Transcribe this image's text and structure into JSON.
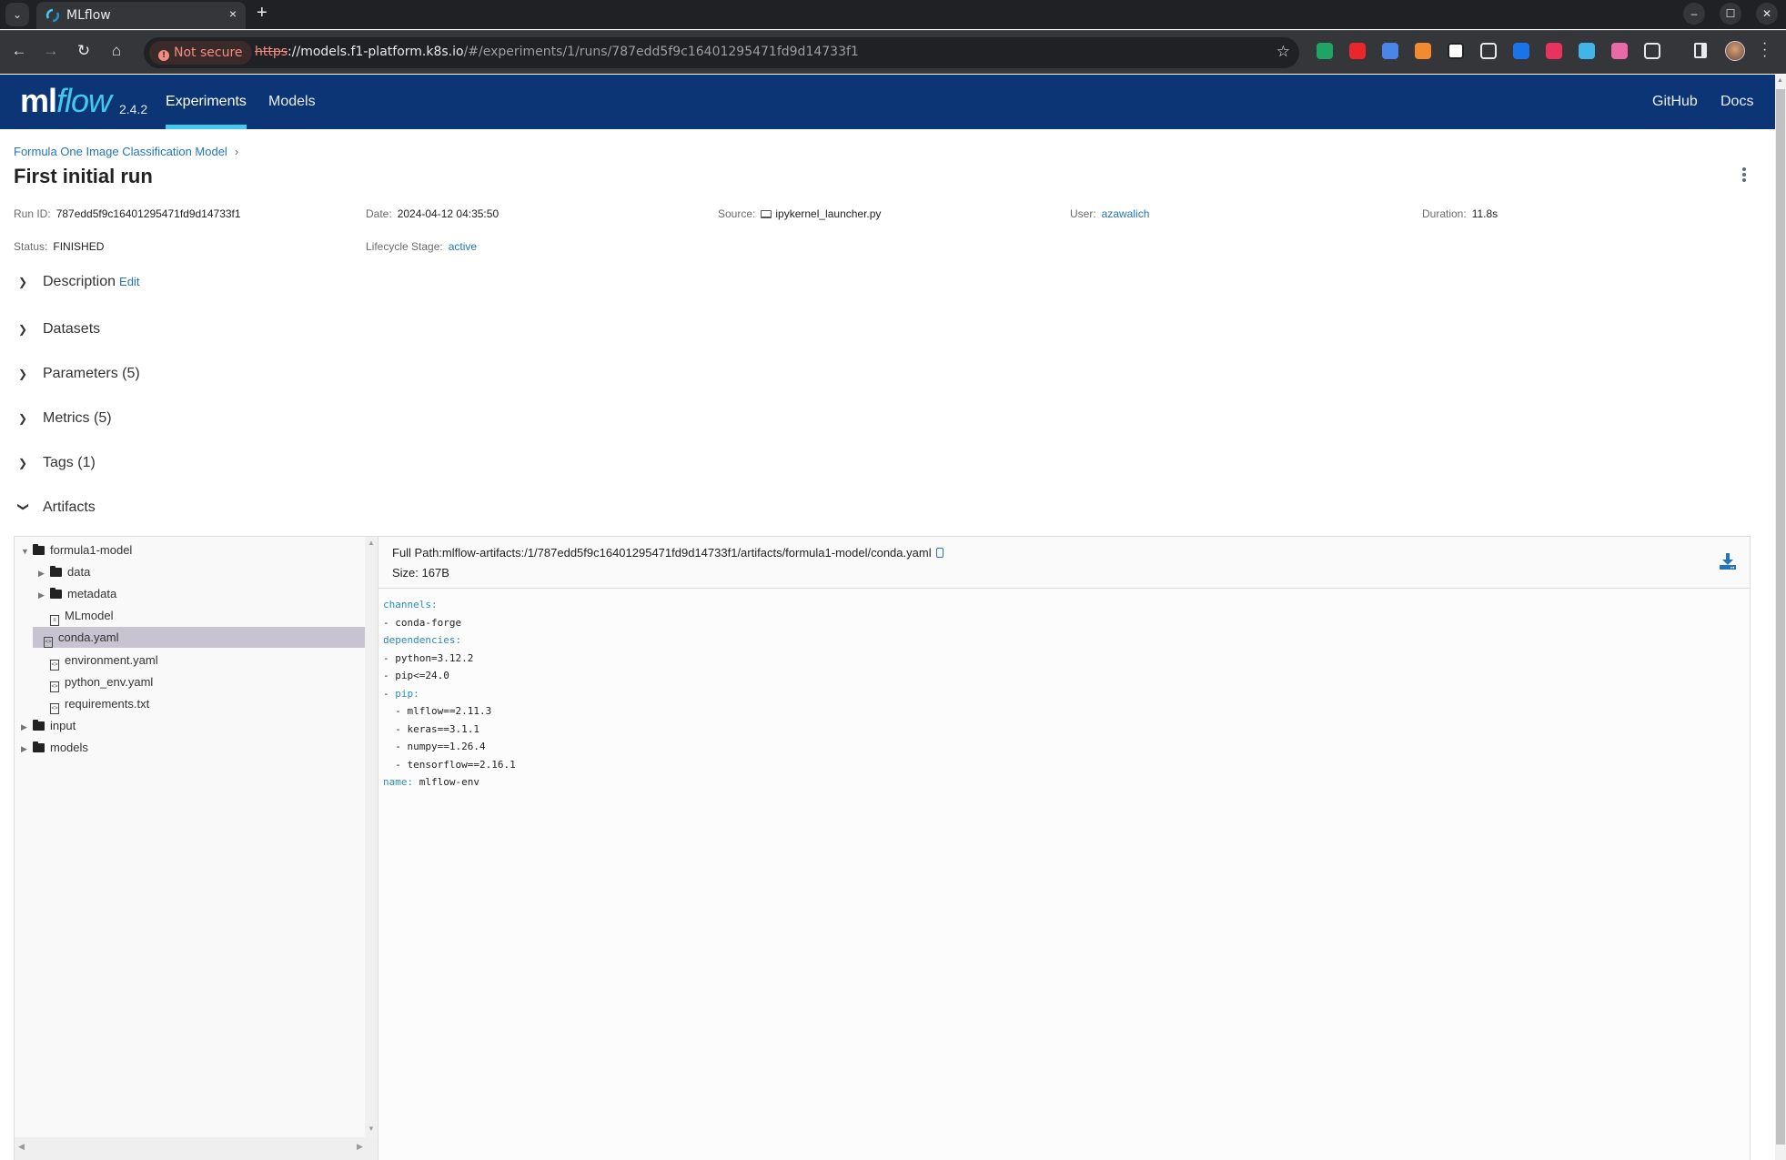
{
  "browser": {
    "tab_title": "MLflow",
    "tab_close": "×",
    "new_tab": "+",
    "tab_list": "⌄",
    "security_label": "Not secure",
    "url_scheme": "https",
    "url_host": "://models.f1-platform.k8s.io",
    "url_path": "/#/experiments/1/runs/787edd5f9c16401295471fd9d14733f1",
    "back": "←",
    "forward": "→",
    "reload": "↻",
    "home": "⌂",
    "bookmark": "☆",
    "minimize": "–",
    "maximize": "☐",
    "close": "✕",
    "extensions": [
      {
        "name": "google-drive-extension-icon",
        "color": "#1fa463"
      },
      {
        "name": "adblock-extension-icon",
        "color": "#e8262b"
      },
      {
        "name": "gem-extension-icon",
        "color": "#4a86e8"
      },
      {
        "name": "toggle-extension-icon",
        "color": "#f28b30"
      },
      {
        "name": "notion-extension-icon",
        "color": "#ffffff"
      },
      {
        "name": "cloud-extension-icon",
        "color": "#e8eaed"
      },
      {
        "name": "sync-extension-icon",
        "color": "#1a73e8"
      },
      {
        "name": "translate-extension-icon",
        "color": "#e8335c"
      },
      {
        "name": "reader-extension-icon",
        "color": "#41b6e6"
      },
      {
        "name": "gradient-extension-icon",
        "color": "#e86aa8"
      },
      {
        "name": "puzzle-extensions-icon",
        "color": "#e8eaed"
      }
    ]
  },
  "header": {
    "logo_ml": "ml",
    "logo_flow": "flow",
    "version": "2.4.2",
    "nav": [
      {
        "label": "Experiments",
        "active": true
      },
      {
        "label": "Models",
        "active": false
      }
    ],
    "right_links": [
      "GitHub",
      "Docs"
    ]
  },
  "page": {
    "breadcrumb": "Formula One Image Classification Model",
    "breadcrumb_sep": "›",
    "title": "First initial run"
  },
  "run_meta": {
    "run_id": {
      "label": "Run ID:",
      "value": "787edd5f9c16401295471fd9d14733f1"
    },
    "date": {
      "label": "Date:",
      "value": "2024-04-12 04:35:50"
    },
    "source": {
      "label": "Source:",
      "value": "ipykernel_launcher.py"
    },
    "user": {
      "label": "User:",
      "value": "azawalich"
    },
    "duration": {
      "label": "Duration:",
      "value": "11.8s"
    },
    "status": {
      "label": "Status:",
      "value": "FINISHED"
    },
    "lifecycle": {
      "label": "Lifecycle Stage:",
      "value": "active"
    }
  },
  "sections": [
    {
      "label": "Description",
      "expanded": false,
      "extra": "Edit"
    },
    {
      "label": "Datasets",
      "expanded": false
    },
    {
      "label": "Parameters (5)",
      "expanded": false
    },
    {
      "label": "Metrics (5)",
      "expanded": false
    },
    {
      "label": "Tags (1)",
      "expanded": false
    },
    {
      "label": "Artifacts",
      "expanded": true
    }
  ],
  "artifacts": {
    "tree": [
      {
        "name": "formula1-model",
        "type": "folder",
        "depth": 0,
        "expanded": true
      },
      {
        "name": "data",
        "type": "folder",
        "depth": 1,
        "expanded": false
      },
      {
        "name": "metadata",
        "type": "folder",
        "depth": 1,
        "expanded": false
      },
      {
        "name": "MLmodel",
        "type": "text-file",
        "depth": 1
      },
      {
        "name": "conda.yaml",
        "type": "code-file",
        "depth": 1,
        "selected": true
      },
      {
        "name": "environment.yaml",
        "type": "code-file",
        "depth": 1
      },
      {
        "name": "python_env.yaml",
        "type": "code-file",
        "depth": 1
      },
      {
        "name": "requirements.txt",
        "type": "code-file",
        "depth": 1
      },
      {
        "name": "input",
        "type": "folder",
        "depth": 0,
        "expanded": false
      },
      {
        "name": "models",
        "type": "folder",
        "depth": 0,
        "expanded": false
      }
    ],
    "full_path_label": "Full Path:",
    "full_path": "mlflow-artifacts:/1/787edd5f9c16401295471fd9d14733f1/artifacts/formula1-model/conda.yaml",
    "size_label": "Size:",
    "size": "167B",
    "file_lines": [
      {
        "key": "channels:",
        "rest": ""
      },
      {
        "key": "",
        "rest": "- conda-forge"
      },
      {
        "key": "dependencies:",
        "rest": ""
      },
      {
        "key": "",
        "rest": "- python=3.12.2"
      },
      {
        "key": "",
        "rest": "- pip<=24.0"
      },
      {
        "prefix": "- ",
        "key": "pip:",
        "rest": ""
      },
      {
        "key": "",
        "rest": "  - mlflow==2.11.3"
      },
      {
        "key": "",
        "rest": "  - keras==3.1.1"
      },
      {
        "key": "",
        "rest": "  - numpy==1.26.4"
      },
      {
        "key": "",
        "rest": "  - tensorflow==2.16.1"
      },
      {
        "key": "name:",
        "rest": " mlflow-env"
      }
    ]
  }
}
